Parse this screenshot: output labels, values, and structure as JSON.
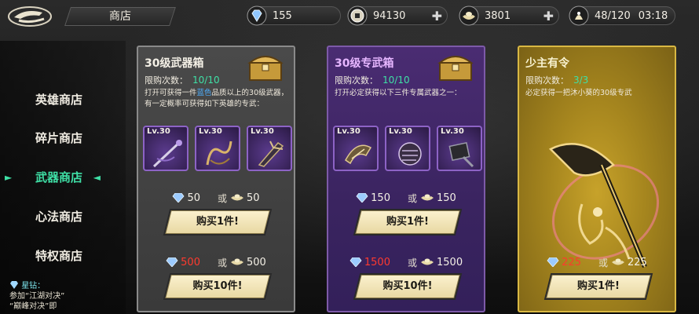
{
  "header": {
    "title": "商店",
    "resources": {
      "diamond": "155",
      "coin": "94130",
      "ingot": "3801",
      "stamina": "48/120",
      "time": "03:18"
    }
  },
  "sidebar": {
    "items": [
      {
        "label": "英雄商店",
        "active": false
      },
      {
        "label": "碎片商店",
        "active": false
      },
      {
        "label": "武器商店",
        "active": true
      },
      {
        "label": "心法商店",
        "active": false
      },
      {
        "label": "特权商店",
        "active": false
      }
    ],
    "note": {
      "head": "星钻：",
      "line1": "参加“江湖对决”",
      "line2": "“巅峰对决”即"
    }
  },
  "cards": [
    {
      "title": "30级武器箱",
      "limit_label": "限购次数：",
      "limit_value": "10/10",
      "desc_a": "打开可获得一件",
      "desc_blue": "蓝色",
      "desc_b": "品质以上的30级武器，有一定概率可获得如下英雄的专武：",
      "items": [
        "Lv.30",
        "Lv.30",
        "Lv.30"
      ],
      "price1": {
        "diamond": "50",
        "or": "或",
        "ingot": "50"
      },
      "buy1": "购买1件!",
      "price10": {
        "diamond": "500",
        "or": "或",
        "ingot": "500"
      },
      "buy10": "购买10件!"
    },
    {
      "title": "30级专武箱",
      "limit_label": "限购次数：",
      "limit_value": "10/10",
      "desc": "打开必定获得以下三件专属武器之一：",
      "items": [
        "Lv.30",
        "Lv.30",
        "Lv.30"
      ],
      "price1": {
        "diamond": "150",
        "or": "或",
        "ingot": "150"
      },
      "buy1": "购买1件!",
      "price10": {
        "diamond": "1500",
        "or": "或",
        "ingot": "1500"
      },
      "buy10": "购买10件!"
    },
    {
      "title": "少主有令",
      "limit_label": "限购次数：",
      "limit_value": "3/3",
      "desc": "必定获得一把沐小葵的30级专武",
      "price1": {
        "diamond": "225",
        "or": "或",
        "ingot": "225"
      },
      "buy1": "购买1件!"
    }
  ],
  "colors": {
    "accent_green": "#3fe0a6",
    "price_red": "#ff3a2e",
    "rare_blue": "#4fb0ff"
  }
}
